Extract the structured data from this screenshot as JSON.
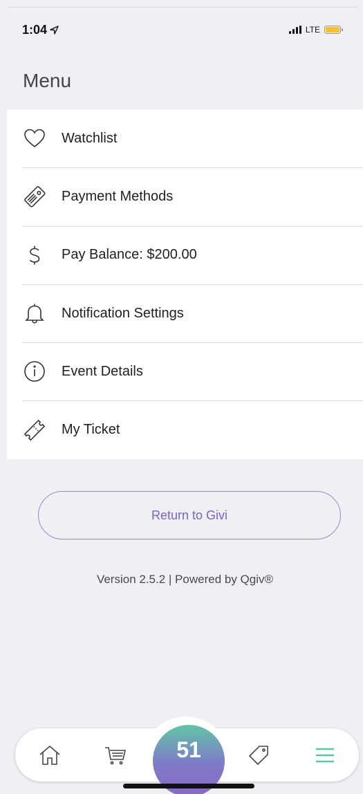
{
  "status_bar": {
    "time": "1:04",
    "network": "LTE",
    "battery_color": "#f6c12d"
  },
  "header": {
    "title": "Menu"
  },
  "menu": {
    "items": [
      {
        "label": "Watchlist",
        "icon": "heart-icon"
      },
      {
        "label": "Payment Methods",
        "icon": "credit-card-icon"
      },
      {
        "label": "Pay Balance: $200.00",
        "icon": "dollar-icon"
      },
      {
        "label": "Notification Settings",
        "icon": "bell-icon"
      },
      {
        "label": "Event Details",
        "icon": "info-icon"
      },
      {
        "label": "My Ticket",
        "icon": "ticket-icon"
      }
    ]
  },
  "return_button": {
    "label": "Return to Givi",
    "color": "#7a62c7"
  },
  "footer": {
    "version_text": "Version 2.5.2 | Powered by Qgiv®"
  },
  "tab_bar": {
    "center_count": "51",
    "active_tab_color": "#5ac7a6",
    "tabs": [
      {
        "icon": "home-icon"
      },
      {
        "icon": "cart-icon"
      },
      {
        "icon": "tag-icon"
      },
      {
        "icon": "hamburger-menu-icon"
      }
    ]
  }
}
